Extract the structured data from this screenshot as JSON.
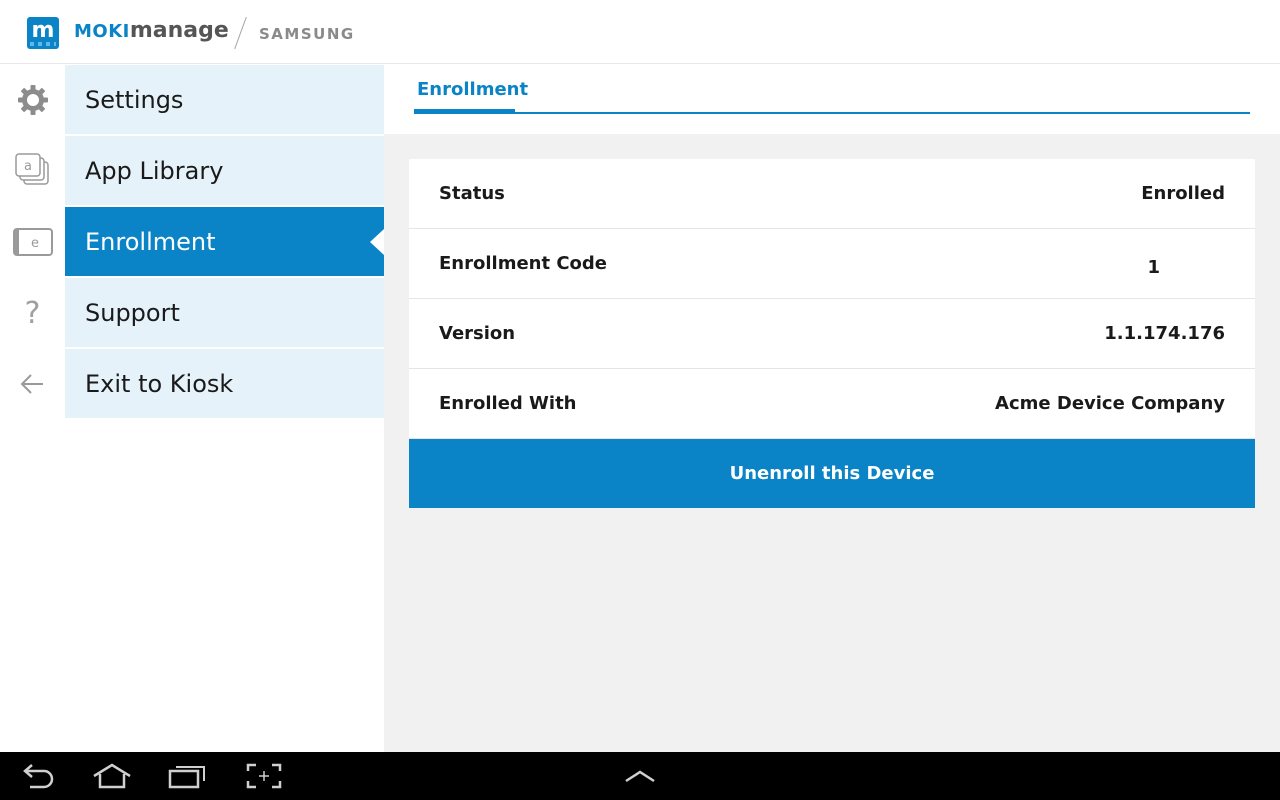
{
  "header": {
    "brand_moki": "MOKI",
    "brand_manage": "manage",
    "partner": "SAMSUNG",
    "logo_letter": "m"
  },
  "sidebar": {
    "items": [
      {
        "label": "Settings",
        "icon": "gear-icon",
        "active": false
      },
      {
        "label": "App Library",
        "icon": "app-library-icon",
        "active": false
      },
      {
        "label": "Enrollment",
        "icon": "enrollment-icon",
        "active": true
      },
      {
        "label": "Support",
        "icon": "question-icon",
        "active": false
      },
      {
        "label": "Exit to Kiosk",
        "icon": "back-arrow-icon",
        "active": false
      }
    ],
    "rail_letters": {
      "app_library": "a",
      "enrollment": "e",
      "support": "?"
    }
  },
  "main": {
    "tab": "Enrollment",
    "rows": [
      {
        "label": "Status",
        "value": "Enrolled"
      },
      {
        "label": "Enrollment Code",
        "value": "1"
      },
      {
        "label": "Version",
        "value": "1.1.174.176"
      },
      {
        "label": "Enrolled With",
        "value": "Acme Device Company"
      }
    ],
    "unenroll_label": "Unenroll this Device"
  },
  "system_bar": {
    "buttons": [
      "back-icon",
      "home-icon",
      "recent-apps-icon",
      "screenshot-icon",
      "chevron-up-icon"
    ]
  },
  "colors": {
    "accent": "#0a84c6",
    "menu_bg": "#e6f2f9",
    "content_bg": "#f1f1f1"
  }
}
